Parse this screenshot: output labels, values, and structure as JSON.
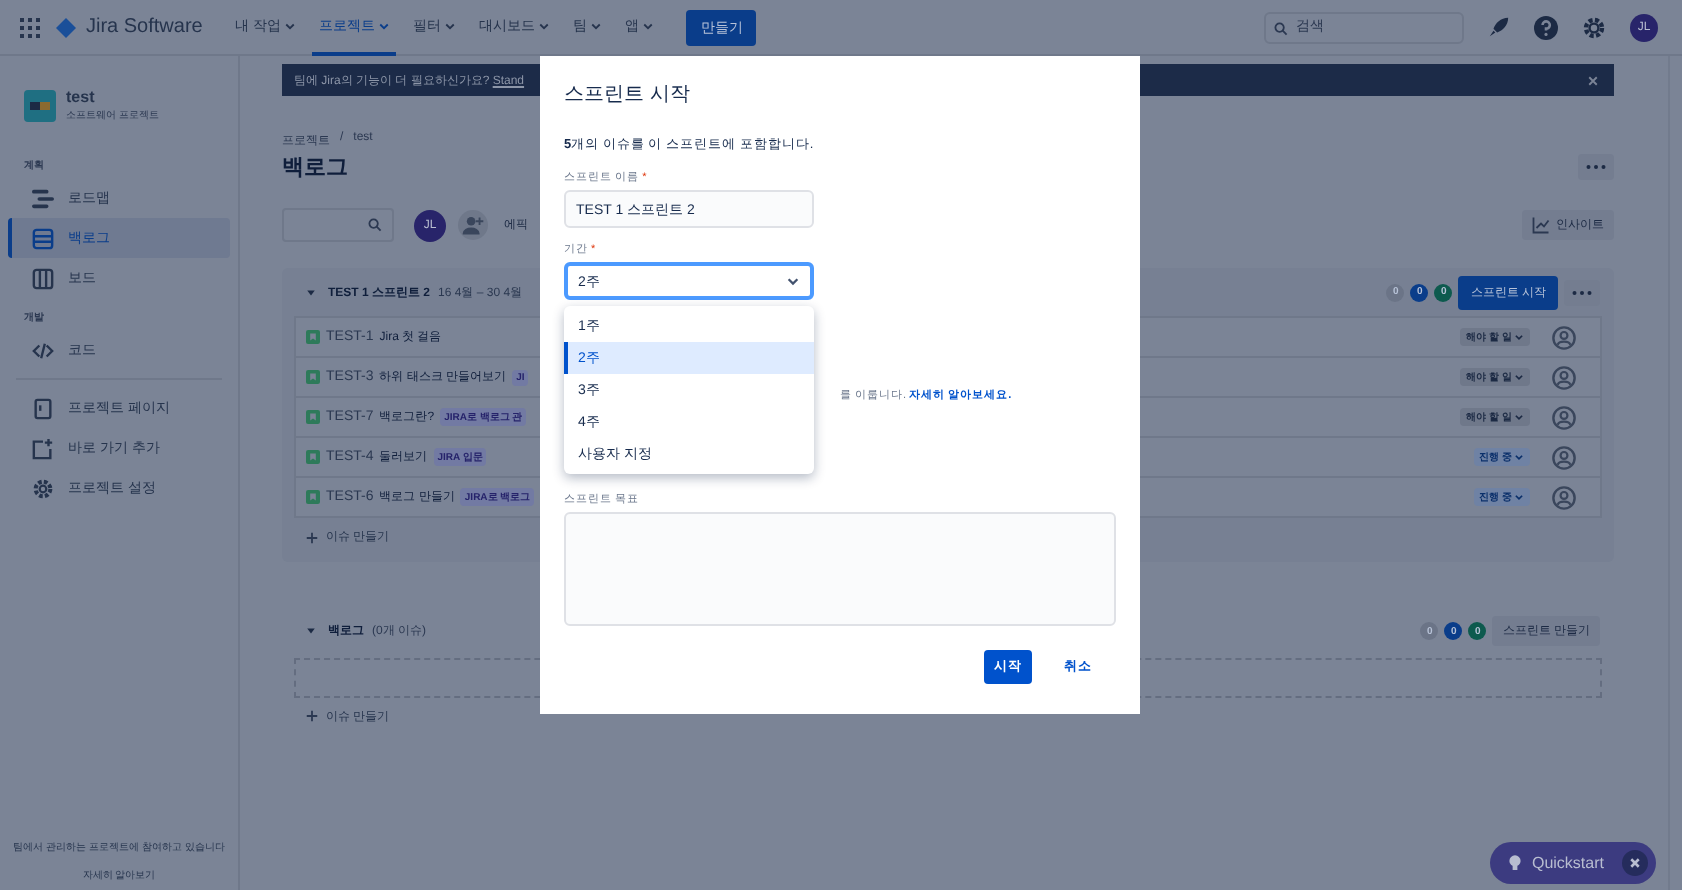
{
  "top_nav": {
    "product": "Jira Software",
    "menus": [
      {
        "label": "내 작업",
        "selected": false
      },
      {
        "label": "프로젝트",
        "selected": true
      },
      {
        "label": "필터",
        "selected": false
      },
      {
        "label": "대시보드",
        "selected": false
      },
      {
        "label": "팀",
        "selected": false
      },
      {
        "label": "앱",
        "selected": false
      }
    ],
    "create_button": "만들기",
    "search": {
      "placeholder": "검색"
    },
    "avatar": "JL"
  },
  "sidebar": {
    "project": {
      "name": "test",
      "type": "소프트웨어 프로젝트"
    },
    "sections": [
      {
        "title": "계획",
        "items": [
          {
            "label": "로드맵",
            "kind": "roadmap",
            "selected": false
          },
          {
            "label": "백로그",
            "kind": "backlog",
            "selected": true
          },
          {
            "label": "보드",
            "kind": "board",
            "selected": false
          }
        ]
      },
      {
        "title": "개발",
        "items": [
          {
            "label": "코드",
            "kind": "code",
            "selected": false
          }
        ]
      }
    ],
    "links": [
      {
        "label": "프로젝트 페이지",
        "kind": "page"
      },
      {
        "label": "바로 가기 추가",
        "kind": "shortcut"
      },
      {
        "label": "프로젝트 설정",
        "kind": "settings"
      }
    ],
    "footer": {
      "text": "팀에서 관리하는 프로젝트에 참여하고 있습니다",
      "link": "자세히 알아보기"
    }
  },
  "banner": {
    "text": "팀에 Jira의 기능이 더 필요하신가요?",
    "link": "Stand"
  },
  "breadcrumbs": {
    "items": [
      "프로젝트",
      "test"
    ],
    "separator": "/"
  },
  "page_title": "백로그",
  "toolbar": {
    "avatar": "JL",
    "epic_filter": "에픽",
    "insights_button": "인사이트"
  },
  "sprint": {
    "name": "TEST 1 스프린트 2",
    "dates": "16 4월 – 30 4월",
    "counts": [
      {
        "value": "0",
        "color": "#6b7487"
      },
      {
        "value": "0",
        "color": "#0a3d8a"
      },
      {
        "value": "0",
        "color": "#0d5a4e"
      }
    ],
    "start_button": "스프린트 시작",
    "issues": [
      {
        "key": "TEST-1",
        "summary": "Jira 첫 걸음",
        "status": "해야 할 일",
        "kind": "todo"
      },
      {
        "key": "TEST-3",
        "summary": "하위 태스크 만들어보기",
        "epic": "JI",
        "status": "해야 할 일",
        "kind": "todo"
      },
      {
        "key": "TEST-7",
        "summary": "백로그란?",
        "epic": "JIRA로 백로그 관",
        "status": "해야 할 일",
        "kind": "todo"
      },
      {
        "key": "TEST-4",
        "summary": "둘러보기",
        "epic": "JIRA 입문",
        "status": "진행 중",
        "kind": "progress"
      },
      {
        "key": "TEST-6",
        "summary": "백로그 만들기",
        "epic": "JIRA로 백로그",
        "status": "진행 중",
        "kind": "progress"
      }
    ],
    "create_issue": "이슈 만들기"
  },
  "backlog": {
    "name": "백로그",
    "count": "(0개 이슈)",
    "counts": [
      {
        "value": "0",
        "color": "#6b7487"
      },
      {
        "value": "0",
        "color": "#0a3d8a"
      },
      {
        "value": "0",
        "color": "#0d5a4e"
      }
    ],
    "create_sprint_button": "스프린트 만들기",
    "create_issue": "이슈 만들기"
  },
  "quickstart": {
    "label": "Quickstart"
  },
  "modal": {
    "title": "스프린트 시작",
    "summary": "**5**개의 이슈를 이 스프린트에 포함합니다.",
    "name_field": {
      "label": "스프린트 이름",
      "required_mark": "*",
      "value": "TEST 1 스프린트 2"
    },
    "duration_field": {
      "label": "기간",
      "required_mark": "*",
      "value": "2주",
      "expanded": true,
      "options": [
        {
          "label": "1주",
          "selected": false
        },
        {
          "label": "2주",
          "selected": true
        },
        {
          "label": "3주",
          "selected": false
        },
        {
          "label": "4주",
          "selected": false
        },
        {
          "label": "사용자 지정",
          "selected": false
        }
      ]
    },
    "hint": "를 이룹니다.",
    "hint_link": "자세히 알아보세요.",
    "goal_field": {
      "label": "스프린트 목표"
    },
    "primary_button": "시작",
    "cancel_button": "취소"
  }
}
